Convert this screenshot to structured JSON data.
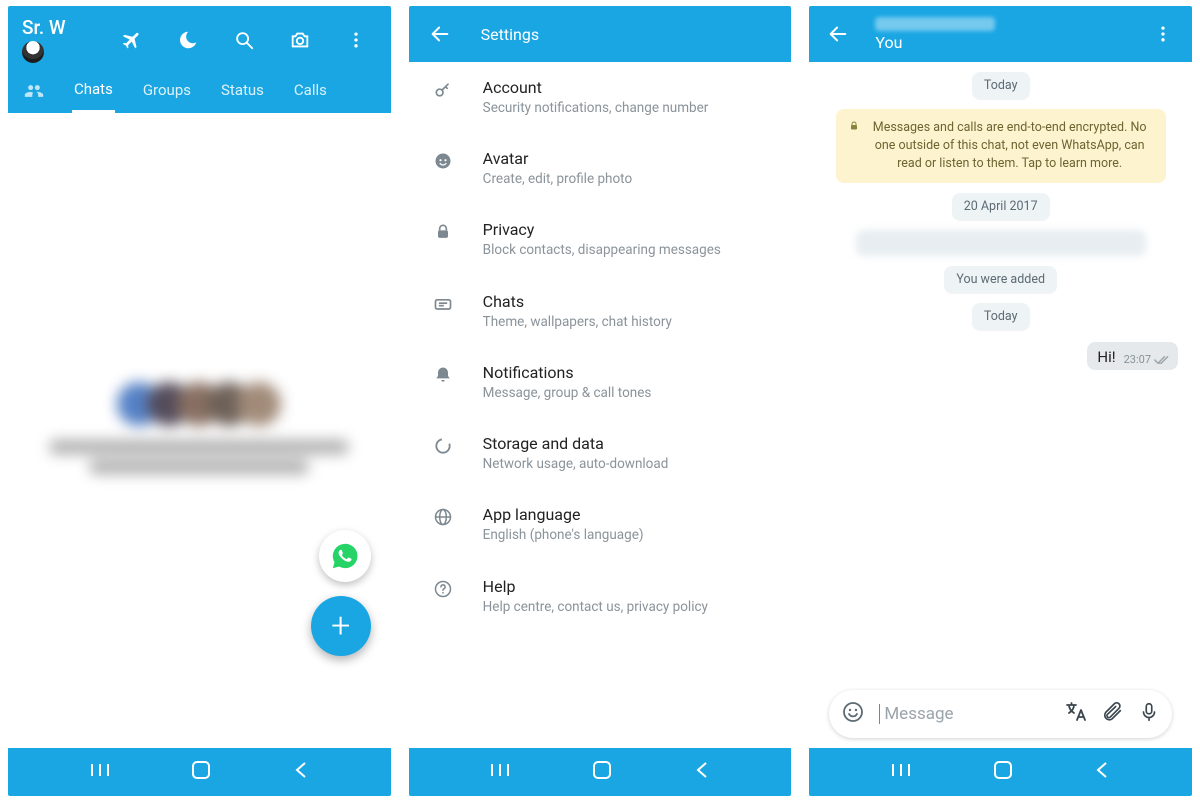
{
  "colors": {
    "accent": "#19A6E3",
    "whatsapp_green": "#25D366"
  },
  "screen1": {
    "user_name": "Sr. W",
    "tabs": {
      "chats": "Chats",
      "groups": "Groups",
      "status": "Status",
      "calls": "Calls"
    },
    "active_tab": "chats"
  },
  "screen2": {
    "title": "Settings",
    "items": [
      {
        "title": "Account",
        "desc": "Security notifications, change number"
      },
      {
        "title": "Avatar",
        "desc": "Create, edit, profile photo"
      },
      {
        "title": "Privacy",
        "desc": "Block contacts, disappearing messages"
      },
      {
        "title": "Chats",
        "desc": "Theme, wallpapers, chat history"
      },
      {
        "title": "Notifications",
        "desc": "Message, group & call tones"
      },
      {
        "title": "Storage and data",
        "desc": "Network usage, auto-download"
      },
      {
        "title": "App language",
        "desc": "English (phone's language)"
      },
      {
        "title": "Help",
        "desc": "Help centre, contact us, privacy policy"
      }
    ]
  },
  "screen3": {
    "subtitle": "You",
    "date_today": "Today",
    "encryption_notice": "Messages and calls are end-to-end encrypted. No one outside of this chat, not even WhatsApp, can read or listen to them. Tap to learn more.",
    "date_past": "20 April 2017",
    "system_added": "You were added",
    "outgoing": {
      "text": "Hi!",
      "time": "23:07"
    },
    "input_placeholder": "Message"
  }
}
